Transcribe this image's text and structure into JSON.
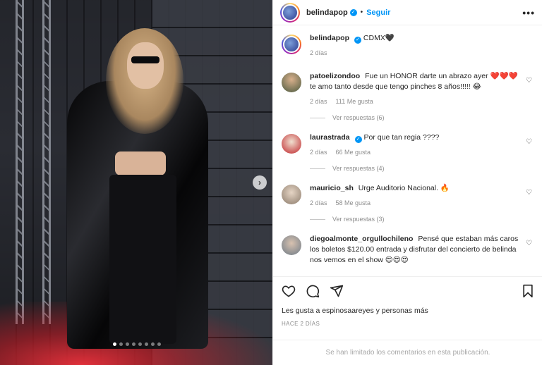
{
  "post": {
    "username": "belindapop",
    "follow_label": "Seguir",
    "separator": "•",
    "more_label": "•••",
    "caption": "CDMX🖤",
    "caption_time": "2 días",
    "carousel": {
      "slides": 8,
      "active_index": 0,
      "next_label": "›"
    }
  },
  "comments": [
    {
      "username": "patoelizondoo",
      "text": "Fue un HONOR darte un abrazo ayer ❤️❤️❤️ te amo tanto desde que tengo pinches 8 años!!!!! 😂",
      "time": "2 días",
      "likes": "111 Me gusta",
      "replies": "Ver respuestas (6)",
      "verified": false
    },
    {
      "username": "laurastrada",
      "text": "Por que tan regia ????",
      "time": "2 días",
      "likes": "66 Me gusta",
      "replies": "Ver respuestas (4)",
      "verified": true
    },
    {
      "username": "mauricio_sh",
      "text": "Urge Auditorio Nacional. 🔥",
      "time": "2 días",
      "likes": "58 Me gusta",
      "replies": "Ver respuestas (3)",
      "verified": false
    },
    {
      "username": "diegoalmonte_orgullochileno",
      "text": "Pensé que estaban más caros los boletos $120.00 entrada y disfrutar del concierto de belinda nos vemos en el show 😍😍😍",
      "time": "",
      "likes": "",
      "replies": "",
      "verified": false
    }
  ],
  "footer": {
    "likes_text": "Les gusta a espinosaareyes y personas más",
    "time_ago": "HACE 2 DÍAS",
    "comments_limited": "Se han limitado los comentarios en esta publicación."
  },
  "colors": {
    "accent": "#0095f6",
    "muted": "#8e8e8e",
    "text": "#262626"
  }
}
